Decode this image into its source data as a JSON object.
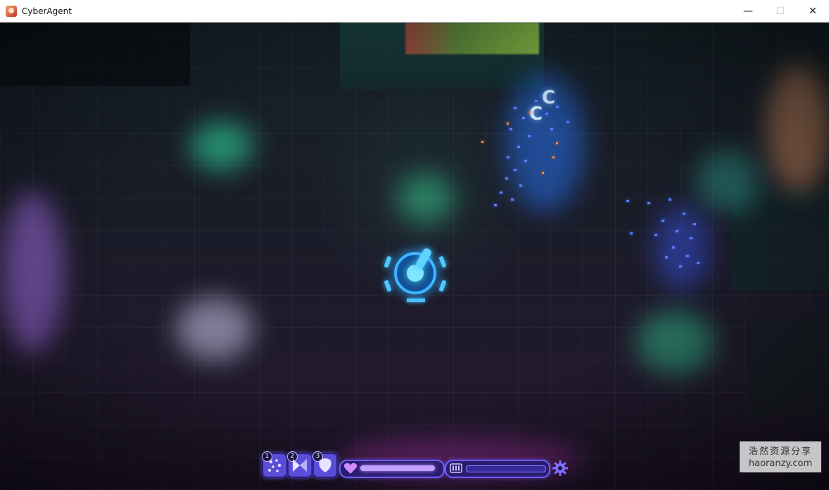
{
  "window": {
    "title": "CyberAgent",
    "app_icon": "anime-avatar-icon",
    "controls": {
      "minimize": "—",
      "maximize": "☐",
      "close": "✕"
    }
  },
  "scene": {
    "floor_letters": [
      "C",
      "C"
    ],
    "colors": {
      "accent_blue": "#3fb6ff",
      "hud_purple": "#6f5cff",
      "glow_green": "#32e6aa"
    }
  },
  "hud": {
    "skills": [
      {
        "number": "1",
        "icon": "scatter-shot-icon"
      },
      {
        "number": "2",
        "icon": "bow-tie-icon"
      },
      {
        "number": "3",
        "icon": "shield-blob-icon"
      }
    ],
    "health": {
      "icon": "heart-icon",
      "fraction": 0.95
    },
    "energy": {
      "icon": "battery-icon",
      "fraction": 0.0
    },
    "settings_icon": "gear-icon"
  },
  "watermark": {
    "line1": "浩然资源分享",
    "line2": "haoranzy.com"
  }
}
